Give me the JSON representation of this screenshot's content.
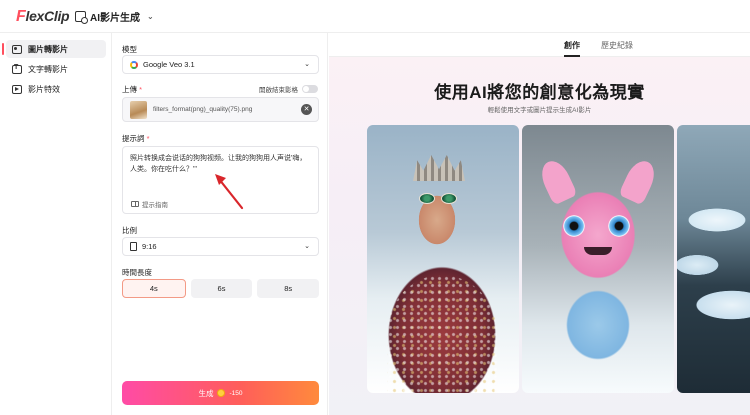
{
  "app": {
    "logo_initial": "F",
    "logo_rest": "lexClip",
    "mode_label": "AI影片生成",
    "mode_chevron": "⌄"
  },
  "nav": {
    "items": [
      {
        "label": "圖片轉影片",
        "icon": "image-icon",
        "active": true
      },
      {
        "label": "文字轉影片",
        "icon": "text-icon",
        "active": false
      },
      {
        "label": "影片特效",
        "icon": "video-effect-icon",
        "active": false
      }
    ]
  },
  "form": {
    "model_label": "模型",
    "model_value": "Google Veo 3.1",
    "upload_label": "上傳",
    "required_mark": "*",
    "end_frame_label": "開啟結束影格",
    "file_name": "filters_format(png)_quality(75).png",
    "remove_symbol": "✕",
    "prompt_label": "提示詞",
    "prompt_text": "照片转换成会说话的狗狗视频。让我的狗狗用人声说'嗨，人类。你在吃什么？'\"",
    "prompt_guide": "提示指南",
    "ratio_label": "比例",
    "ratio_value": "9:16",
    "duration_label": "時間長度",
    "durations": [
      "4s",
      "6s",
      "8s"
    ],
    "selected_duration": "4s",
    "generate_label": "生成",
    "generate_cost": "-150"
  },
  "preview": {
    "tabs": [
      "創作",
      "歷史紀錄"
    ],
    "active_tab": "創作",
    "headline": "使用AI將您的創意化為現實",
    "subline": "輕鬆使用文字或圖片提示生成AI影片"
  },
  "colors": {
    "accent": "#ff4f5e",
    "generate_gradient_start": "#ff4ba6",
    "generate_gradient_end": "#ff8a3c",
    "arrow": "#d9262b"
  }
}
